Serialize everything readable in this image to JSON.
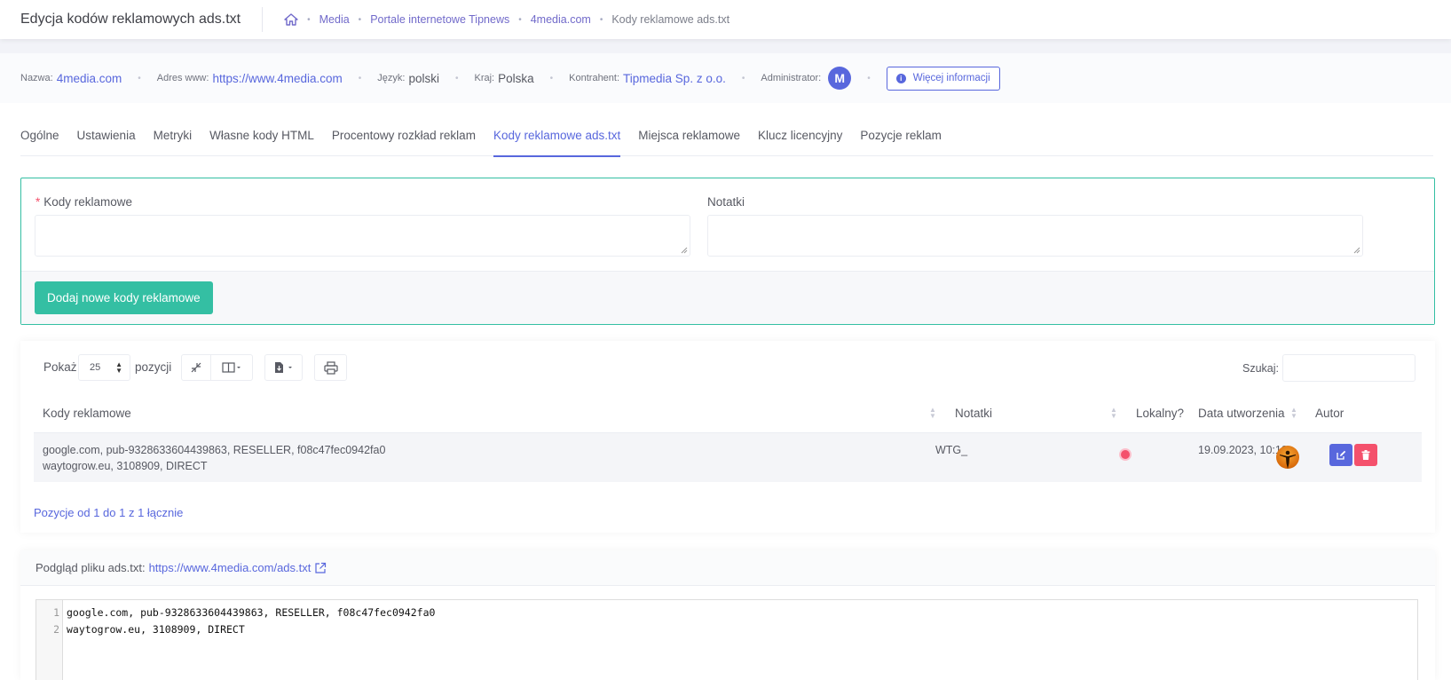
{
  "header": {
    "title": "Edycja kodów reklamowych ads.txt",
    "breadcrumbs": [
      "Media",
      "Portale internetowe Tipnews",
      "4media.com",
      "Kody reklamowe ads.txt"
    ]
  },
  "info": {
    "name_label": "Nazwa:",
    "name_value": "4media.com",
    "www_label": "Adres www:",
    "www_value": "https://www.4media.com",
    "lang_label": "Język:",
    "lang_value": "polski",
    "country_label": "Kraj:",
    "country_value": "Polska",
    "contractor_label": "Kontrahent:",
    "contractor_value": "Tipmedia Sp. z o.o.",
    "admin_label": "Administrator:",
    "admin_initial": "M",
    "more_info_label": "Więcej informacji"
  },
  "tabs": [
    "Ogólne",
    "Ustawienia",
    "Metryki",
    "Własne kody HTML",
    "Procentowy rozkład reklam",
    "Kody reklamowe ads.txt",
    "Miejsca reklamowe",
    "Klucz licencyjny",
    "Pozycje reklam"
  ],
  "active_tab": "Kody reklamowe ads.txt",
  "form": {
    "required_mark": "*",
    "codes_label": "Kody reklamowe",
    "notes_label": "Notatki",
    "submit_label": "Dodaj nowe kody reklamowe"
  },
  "table": {
    "show_label": "Pokaż",
    "page_size": "25",
    "entries_label": "pozycji",
    "search_label": "Szukaj:",
    "columns": [
      "Kody reklamowe",
      "Notatki",
      "Lokalny?",
      "Data utworzenia",
      "Autor"
    ],
    "rows": [
      {
        "codes_line1": "google.com, pub-9328633604439863, RESELLER, f08c47fec0942fa0",
        "codes_line2": "waytogrow.eu, 3108909, DIRECT",
        "notes": "WTG_",
        "created": "19.09.2023, 10:19"
      }
    ],
    "footer_info": "Pozycje od 1 do 1 z 1 łącznie"
  },
  "preview": {
    "label": "Podgląd pliku ads.txt:",
    "url": "https://www.4media.com/ads.txt",
    "lines": [
      "google.com, pub-9328633604439863, RESELLER, f08c47fec0942fa0",
      "waytogrow.eu, 3108909, DIRECT"
    ]
  },
  "colors": {
    "accent": "#5867dd",
    "success": "#34bfa3",
    "danger": "#f4516c"
  }
}
